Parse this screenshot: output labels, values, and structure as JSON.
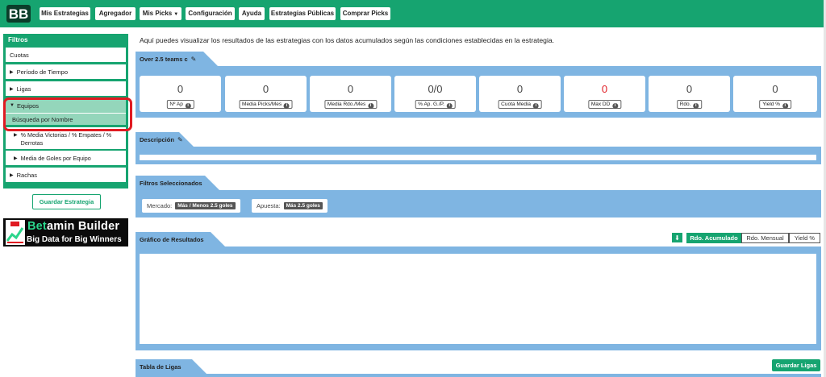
{
  "brand": {
    "logo_icon": "betamin-logo",
    "accent": "#16a470",
    "panel_blue": "#7fb5e2",
    "alert_red": "#e01b22"
  },
  "navbar": {
    "items": [
      {
        "label": "Mis Estrategias"
      },
      {
        "label": "Agregador"
      },
      {
        "label": "Mis Picks"
      },
      {
        "label": "Configuración"
      },
      {
        "label": "Ayuda"
      },
      {
        "label": "Estrategias Públicas"
      },
      {
        "label": "Comprar Picks"
      }
    ]
  },
  "sidebar": {
    "header": "Filtros",
    "cuotas": "Cuotas",
    "periodo": "Período de Tiempo",
    "ligas": "Ligas",
    "equipos": "Equipos",
    "busqueda": "Búsqueda por Nombre",
    "media_victorias": "% Media Victorias / % Empates / % Derrotas",
    "media_goles": "Media de Goles por Equipo",
    "rachas": "Rachas",
    "save_button": "Guardar Estrategia"
  },
  "banner": {
    "title_highlight": "Bet",
    "title_rest": "amin Builder",
    "subtitle": "Big Data for Big Winners"
  },
  "main": {
    "intro": "Aquí puedes visualizar los resultados de las estrategias con los datos acumulados según las condiciones establecidas en la estrategia.",
    "strategy_name": "Over 2.5 teams c",
    "stats": [
      {
        "value": "0",
        "label": "Nº Ap"
      },
      {
        "value": "0",
        "label": "Media Picks/Mes"
      },
      {
        "value": "0",
        "label": "Media Rdo./Mes"
      },
      {
        "value": "0/0",
        "label": "% Ap. G./P."
      },
      {
        "value": "0",
        "label": "Cuota Media"
      },
      {
        "value": "0",
        "label": "Max DD"
      },
      {
        "value": "0",
        "label": "Rdo."
      },
      {
        "value": "0",
        "label": "Yield %"
      }
    ],
    "descripcion": "Descripción",
    "filtros_seleccionados": "Filtros Seleccionados",
    "mercado_label": "Mercado:",
    "mercado_value": "Más / Menos 2.5 goles",
    "apuesta_label": "Apuesta:",
    "apuesta_value": "Más 2.5 goles",
    "grafico": "Gráfico de Resultados",
    "chart_tabs": [
      "Rdo. Acumulado",
      "Rdo. Mensual",
      "Yield %"
    ],
    "tabla_ligas": "Tabla de Ligas",
    "save_leagues": "Guardar Ligas"
  }
}
